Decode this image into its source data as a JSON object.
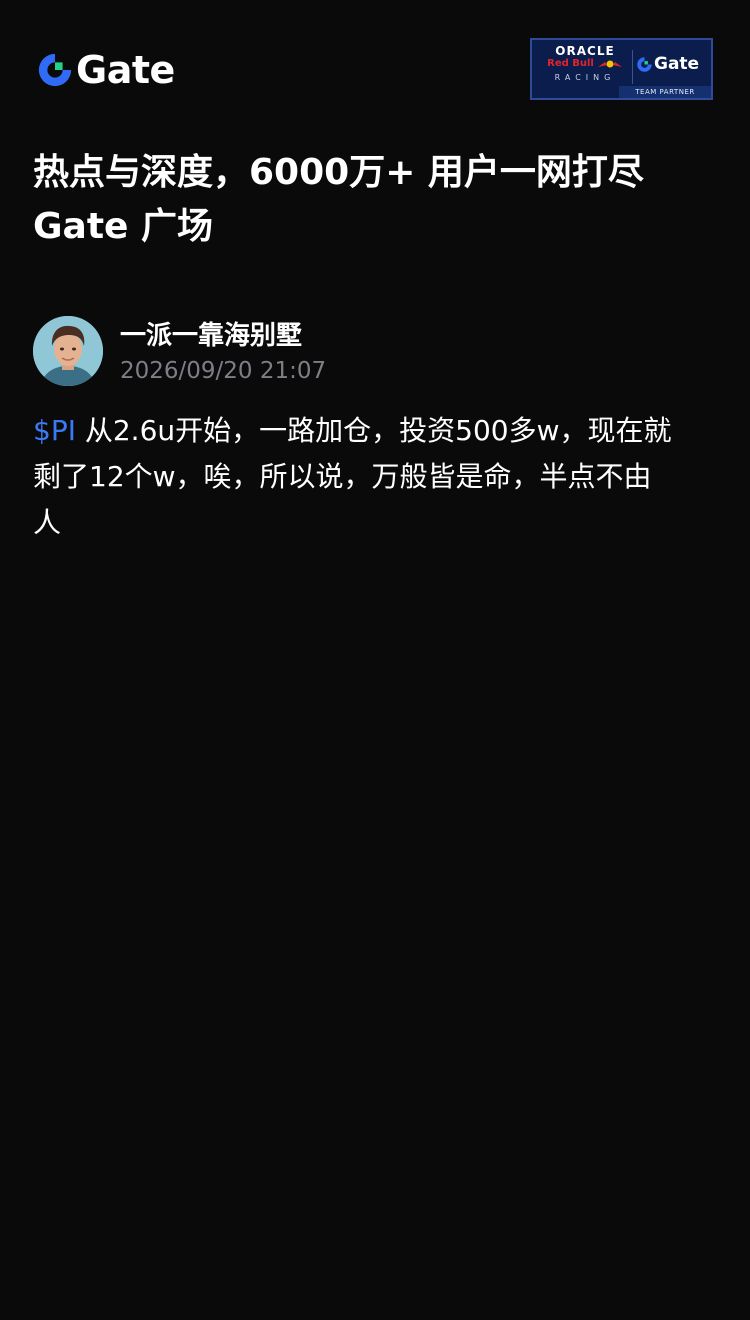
{
  "brand": {
    "name": "Gate",
    "accent_blue": "#2f6bf6",
    "accent_green": "#23d18b"
  },
  "partner_badge": {
    "line1": "ORACLE",
    "line2": "Red Bull",
    "line3": "RACING",
    "gate_name": "Gate",
    "tag": "TEAM PARTNER"
  },
  "headline": {
    "line1": "热点与深度，6000万+ 用户一网打尽",
    "line2": "Gate 广场"
  },
  "post": {
    "author": "一派一靠海别墅",
    "timestamp": "2026/09/20 21:07",
    "ticker": "$PI",
    "body_line1": " 从2.6u开始，一路加仓，投资500多w，现在就",
    "body_line2": "剩了12个w，唉，所以说，万般皆是命，半点不由",
    "body_line3": "人",
    "ticker_color": "#3a7bf5"
  }
}
